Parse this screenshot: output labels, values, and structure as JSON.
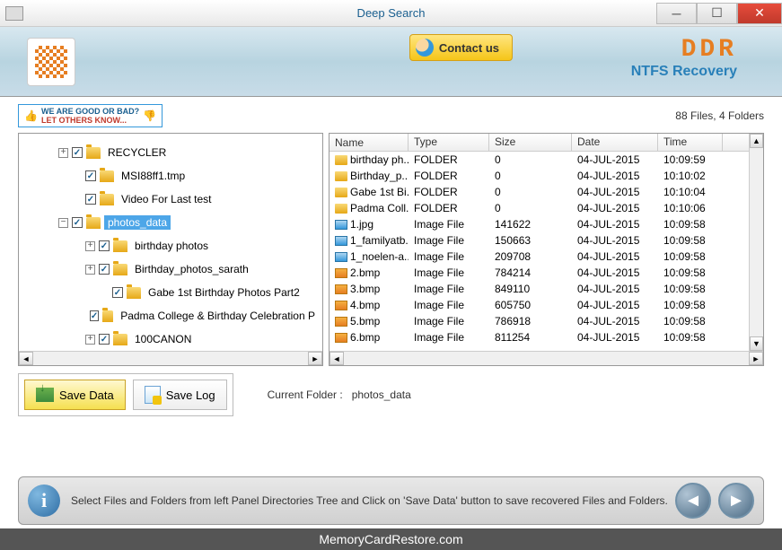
{
  "titlebar": {
    "title": "Deep Search"
  },
  "banner": {
    "contact": "Contact us",
    "brand": "DDR",
    "subtitle": "NTFS Recovery"
  },
  "feedback": {
    "line1": "WE ARE GOOD OR BAD?",
    "line2": "LET OTHERS KNOW..."
  },
  "stats": {
    "counts": "88 Files, 4 Folders"
  },
  "tree": {
    "items": [
      {
        "indent": 40,
        "exp": "+",
        "chk": true,
        "label": "RECYCLER"
      },
      {
        "indent": 55,
        "exp": "",
        "chk": true,
        "label": "MSI88ff1.tmp"
      },
      {
        "indent": 55,
        "exp": "",
        "chk": true,
        "label": "Video For Last test"
      },
      {
        "indent": 40,
        "exp": "−",
        "chk": true,
        "label": "photos_data",
        "selected": true
      },
      {
        "indent": 70,
        "exp": "+",
        "chk": true,
        "label": "birthday photos"
      },
      {
        "indent": 70,
        "exp": "+",
        "chk": true,
        "label": "Birthday_photos_sarath"
      },
      {
        "indent": 85,
        "exp": "",
        "chk": true,
        "label": "Gabe 1st Birthday Photos Part2"
      },
      {
        "indent": 85,
        "exp": "",
        "chk": true,
        "label": "Padma College & Birthday Celebration P"
      },
      {
        "indent": 70,
        "exp": "+",
        "chk": true,
        "label": "100CANON"
      }
    ]
  },
  "filetable": {
    "headers": {
      "name": "Name",
      "type": "Type",
      "size": "Size",
      "date": "Date",
      "time": "Time"
    },
    "rows": [
      {
        "icon": "folder",
        "name": "birthday ph...",
        "type": "FOLDER",
        "size": "0",
        "date": "04-JUL-2015",
        "time": "10:09:59"
      },
      {
        "icon": "folder",
        "name": "Birthday_p...",
        "type": "FOLDER",
        "size": "0",
        "date": "04-JUL-2015",
        "time": "10:10:02"
      },
      {
        "icon": "folder",
        "name": "Gabe 1st Bi...",
        "type": "FOLDER",
        "size": "0",
        "date": "04-JUL-2015",
        "time": "10:10:04"
      },
      {
        "icon": "folder",
        "name": "Padma Coll...",
        "type": "FOLDER",
        "size": "0",
        "date": "04-JUL-2015",
        "time": "10:10:06"
      },
      {
        "icon": "img",
        "name": "1.jpg",
        "type": "Image File",
        "size": "141622",
        "date": "04-JUL-2015",
        "time": "10:09:58"
      },
      {
        "icon": "img",
        "name": "1_familyatb...",
        "type": "Image File",
        "size": "150663",
        "date": "04-JUL-2015",
        "time": "10:09:58"
      },
      {
        "icon": "img",
        "name": "1_noelen-a...",
        "type": "Image File",
        "size": "209708",
        "date": "04-JUL-2015",
        "time": "10:09:58"
      },
      {
        "icon": "bmp",
        "name": "2.bmp",
        "type": "Image File",
        "size": "784214",
        "date": "04-JUL-2015",
        "time": "10:09:58"
      },
      {
        "icon": "bmp",
        "name": "3.bmp",
        "type": "Image File",
        "size": "849110",
        "date": "04-JUL-2015",
        "time": "10:09:58"
      },
      {
        "icon": "bmp",
        "name": "4.bmp",
        "type": "Image File",
        "size": "605750",
        "date": "04-JUL-2015",
        "time": "10:09:58"
      },
      {
        "icon": "bmp",
        "name": "5.bmp",
        "type": "Image File",
        "size": "786918",
        "date": "04-JUL-2015",
        "time": "10:09:58"
      },
      {
        "icon": "bmp",
        "name": "6.bmp",
        "type": "Image File",
        "size": "811254",
        "date": "04-JUL-2015",
        "time": "10:09:58"
      }
    ]
  },
  "actions": {
    "save_data": "Save Data",
    "save_log": "Save Log"
  },
  "current": {
    "label": "Current Folder :",
    "value": "photos_data"
  },
  "footer": {
    "text": "Select Files and Folders from left Panel Directories Tree and Click on 'Save Data' button to save recovered Files and Folders."
  },
  "watermark": "MemoryCardRestore.com"
}
